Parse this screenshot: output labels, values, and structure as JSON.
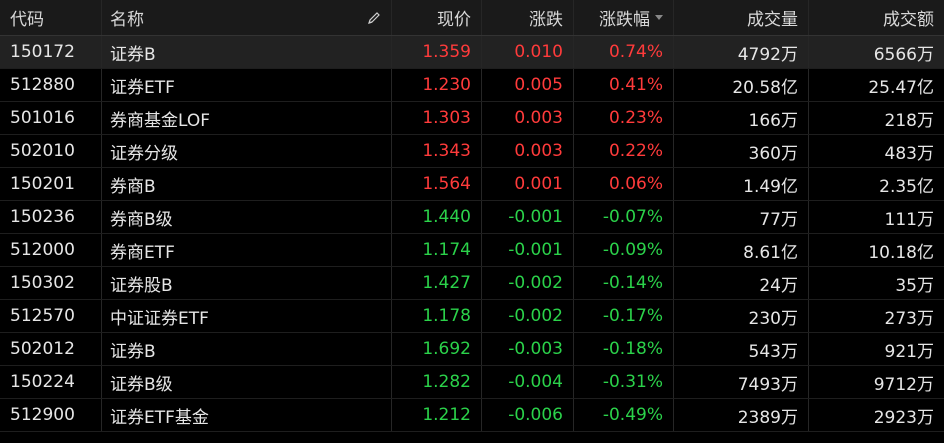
{
  "header": {
    "code": "代码",
    "name": "名称",
    "price": "现价",
    "change": "涨跌",
    "pct": "涨跌幅",
    "volume": "成交量",
    "amount": "成交额"
  },
  "colors": {
    "up": "#ff3b3b",
    "down": "#2bd24a"
  },
  "rows": [
    {
      "code": "150172",
      "name": "证券B",
      "price": "1.359",
      "change": "0.010",
      "pct": "0.74%",
      "volume": "4792万",
      "amount": "6566万",
      "dir": "up"
    },
    {
      "code": "512880",
      "name": "证券ETF",
      "price": "1.230",
      "change": "0.005",
      "pct": "0.41%",
      "volume": "20.58亿",
      "amount": "25.47亿",
      "dir": "up"
    },
    {
      "code": "501016",
      "name": "券商基金LOF",
      "price": "1.303",
      "change": "0.003",
      "pct": "0.23%",
      "volume": "166万",
      "amount": "218万",
      "dir": "up"
    },
    {
      "code": "502010",
      "name": "证券分级",
      "price": "1.343",
      "change": "0.003",
      "pct": "0.22%",
      "volume": "360万",
      "amount": "483万",
      "dir": "up"
    },
    {
      "code": "150201",
      "name": "券商B",
      "price": "1.564",
      "change": "0.001",
      "pct": "0.06%",
      "volume": "1.49亿",
      "amount": "2.35亿",
      "dir": "up"
    },
    {
      "code": "150236",
      "name": "券商B级",
      "price": "1.440",
      "change": "-0.001",
      "pct": "-0.07%",
      "volume": "77万",
      "amount": "111万",
      "dir": "down"
    },
    {
      "code": "512000",
      "name": "券商ETF",
      "price": "1.174",
      "change": "-0.001",
      "pct": "-0.09%",
      "volume": "8.61亿",
      "amount": "10.18亿",
      "dir": "down"
    },
    {
      "code": "150302",
      "name": "证券股B",
      "price": "1.427",
      "change": "-0.002",
      "pct": "-0.14%",
      "volume": "24万",
      "amount": "35万",
      "dir": "down"
    },
    {
      "code": "512570",
      "name": "中证证券ETF",
      "price": "1.178",
      "change": "-0.002",
      "pct": "-0.17%",
      "volume": "230万",
      "amount": "273万",
      "dir": "down"
    },
    {
      "code": "502012",
      "name": "证券B",
      "price": "1.692",
      "change": "-0.003",
      "pct": "-0.18%",
      "volume": "543万",
      "amount": "921万",
      "dir": "down"
    },
    {
      "code": "150224",
      "name": "证券B级",
      "price": "1.282",
      "change": "-0.004",
      "pct": "-0.31%",
      "volume": "7493万",
      "amount": "9712万",
      "dir": "down"
    },
    {
      "code": "512900",
      "name": "证券ETF基金",
      "price": "1.212",
      "change": "-0.006",
      "pct": "-0.49%",
      "volume": "2389万",
      "amount": "2923万",
      "dir": "down"
    }
  ]
}
